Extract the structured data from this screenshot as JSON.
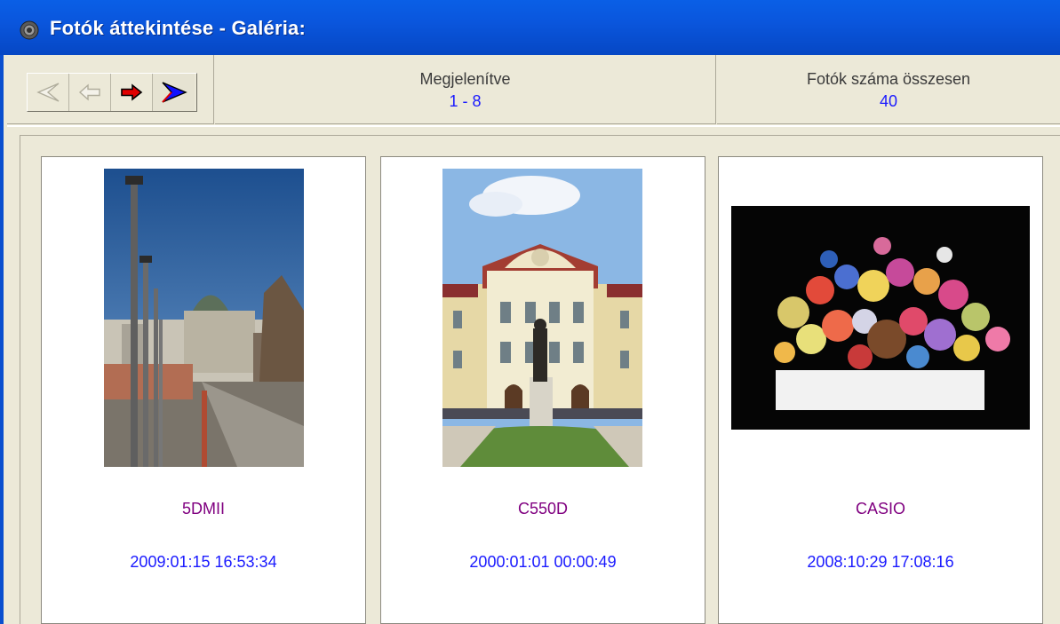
{
  "window": {
    "title": "Fotók áttekintése - Galéria:",
    "icon": "camera-icon"
  },
  "toolbar": {
    "nav_buttons": [
      {
        "icon": "first-page-icon",
        "enabled": false
      },
      {
        "icon": "prev-page-icon",
        "enabled": false
      },
      {
        "icon": "next-page-icon",
        "enabled": true,
        "color": "#e00000"
      },
      {
        "icon": "last-page-icon",
        "enabled": true,
        "color": "#1010ff"
      }
    ],
    "displayed_label": "Megjelenítve",
    "displayed_value": "1 - 8",
    "total_label": "Fotók száma összesen",
    "total_value": "40"
  },
  "photos": [
    {
      "camera": "5DMII",
      "date": "2009:01:15 16:53:34",
      "orientation": "portrait",
      "subject": "street-lamps-city-square"
    },
    {
      "camera": "C550D",
      "date": "2000:01:01 00:00:49",
      "orientation": "portrait",
      "subject": "palace-with-statue"
    },
    {
      "camera": "CASIO",
      "date": "2008:10:29 17:08:16",
      "orientation": "landscape",
      "subject": "dried-flower-arrangement"
    }
  ],
  "colors": {
    "title_bar": "#0a56dd",
    "camera_text": "#800080",
    "date_text": "#1a1aff",
    "value_text": "#1a1aff"
  }
}
